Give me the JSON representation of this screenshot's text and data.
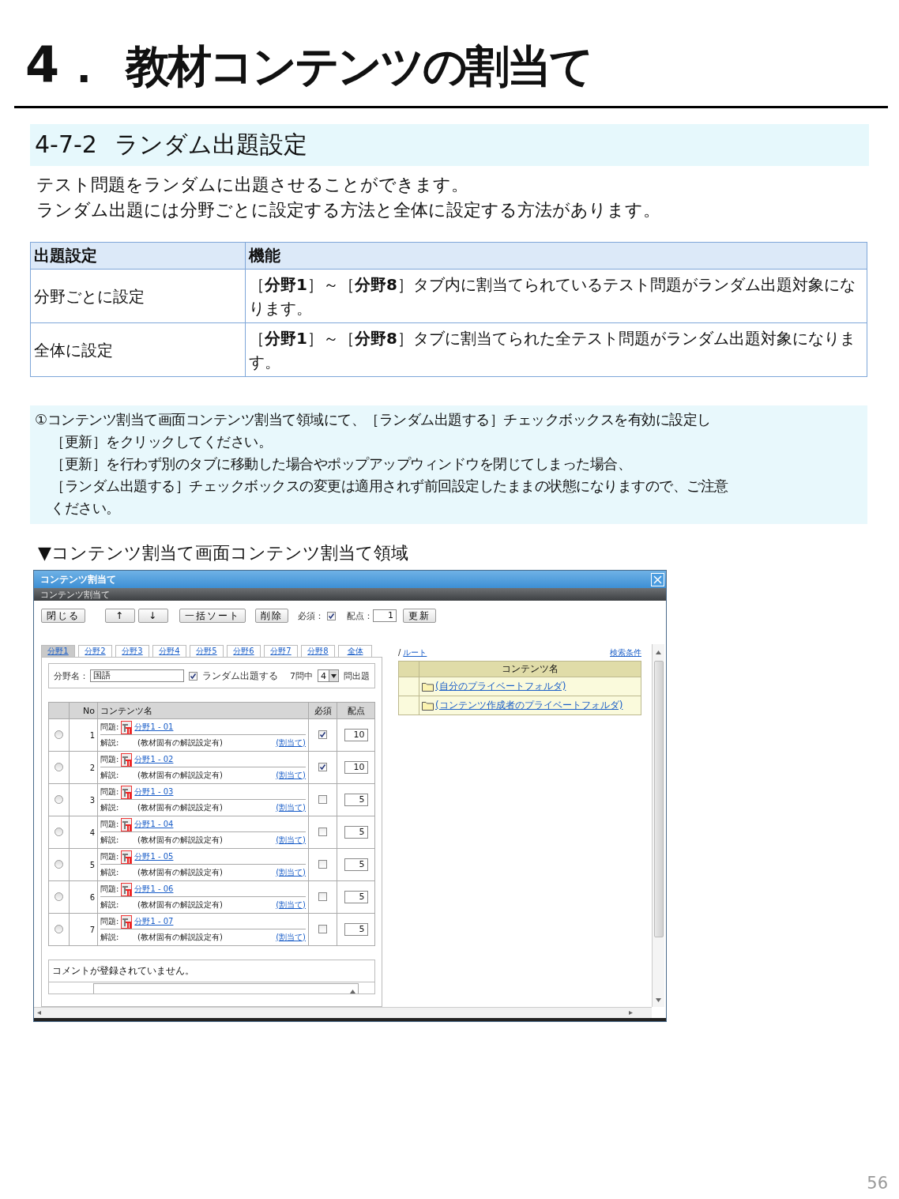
{
  "heading": {
    "number": "4．",
    "title": "教材コンテンツの割当て"
  },
  "section": {
    "number": "4-7-2",
    "title": "ランダム出題設定"
  },
  "intro": [
    "テスト問題をランダムに出題させることができます。",
    "ランダム出題には分野ごとに設定する方法と全体に設定する方法があります。"
  ],
  "table": {
    "columns": [
      "出題設定",
      "機能"
    ],
    "rows": [
      {
        "setting": "分野ごとに設定",
        "function": "［**分野1**］～［**分野8**］タブ内に割当てられているテスト問題がランダム出題対象になります。"
      },
      {
        "setting": "全体に設定",
        "function": "［**分野1**］～［**分野8**］タブに割当てられた全テスト問題がランダム出題対象になります。"
      }
    ]
  },
  "note": [
    "①コンテンツ割当て画面コンテンツ割当て領域にて、［ランダム出題する］チェックボックスを有効に設定し",
    "［更新］をクリックしてください。",
    "［更新］を行わず別のタブに移動した場合やポップアップウィンドウを閉じてしまった場合、",
    "［ランダム出題する］チェックボックスの変更は適用されず前回設定したままの状態になりますので、ご注意",
    "ください。"
  ],
  "caption": "▼コンテンツ割当て画面コンテンツ割当て領域",
  "app": {
    "window_title": "コンテンツ割当て",
    "subtitle": "コンテンツ割当て",
    "toolbar": {
      "buttons": [
        "閉じる",
        "↑",
        "↓",
        "一括ソート",
        "削除"
      ],
      "required_label": "必須：",
      "required_checked": true,
      "points_label": "配点：",
      "points_value": "1",
      "update_button": "更新"
    },
    "tabs": [
      {
        "label": "分野1",
        "selected": true
      },
      {
        "label": "分野2",
        "selected": false
      },
      {
        "label": "分野3",
        "selected": false
      },
      {
        "label": "分野4",
        "selected": false
      },
      {
        "label": "分野5",
        "selected": false
      },
      {
        "label": "分野6",
        "selected": false
      },
      {
        "label": "分野7",
        "selected": false
      },
      {
        "label": "分野8",
        "selected": false
      },
      {
        "label": "全体",
        "selected": false
      }
    ],
    "field": {
      "label": "分野名：",
      "value": "国語"
    },
    "random": {
      "label": "ランダム出題する",
      "checked": true
    },
    "count": {
      "prefix": "7問中",
      "value": "4",
      "suffix": "問出題"
    },
    "columns": [
      "No",
      "コンテンツ名",
      "必須",
      "配点"
    ],
    "rows": [
      {
        "selected": false,
        "no": "1",
        "question_label": "問題:",
        "question": "分野1 - 01",
        "explanation_label": "解説:",
        "explanation": "(教材固有の解説設定有)",
        "assign": "(割当て)",
        "required": true,
        "points": "10"
      },
      {
        "selected": false,
        "no": "2",
        "question_label": "問題:",
        "question": "分野1 - 02",
        "explanation_label": "解説:",
        "explanation": "(教材固有の解説設定有)",
        "assign": "(割当て)",
        "required": true,
        "points": "10"
      },
      {
        "selected": false,
        "no": "3",
        "question_label": "問題:",
        "question": "分野1 - 03",
        "explanation_label": "解説:",
        "explanation": "(教材固有の解説設定有)",
        "assign": "(割当て)",
        "required": false,
        "points": "5"
      },
      {
        "selected": false,
        "no": "4",
        "question_label": "問題:",
        "question": "分野1 - 04",
        "explanation_label": "解説:",
        "explanation": "(教材固有の解説設定有)",
        "assign": "(割当て)",
        "required": false,
        "points": "5"
      },
      {
        "selected": false,
        "no": "5",
        "question_label": "問題:",
        "question": "分野1 - 05",
        "explanation_label": "解説:",
        "explanation": "(教材固有の解説設定有)",
        "assign": "(割当て)",
        "required": false,
        "points": "5"
      },
      {
        "selected": false,
        "no": "6",
        "question_label": "問題:",
        "question": "分野1 - 06",
        "explanation_label": "解説:",
        "explanation": "(教材固有の解説設定有)",
        "assign": "(割当て)",
        "required": false,
        "points": "5"
      },
      {
        "selected": false,
        "no": "7",
        "question_label": "問題:",
        "question": "分野1 - 07",
        "explanation_label": "解説:",
        "explanation": "(教材固有の解説設定有)",
        "assign": "(割当て)",
        "required": false,
        "points": "5"
      }
    ],
    "comment": "コメントが登録されていません。",
    "path": {
      "separator": "/",
      "root": "ルート",
      "search": "検索条件"
    },
    "folders": {
      "column": "コンテンツ名",
      "items": [
        "(自分のプライベートフォルダ)",
        "(コンテンツ作成者のプライベートフォルダ)"
      ]
    }
  },
  "page_number": "56"
}
